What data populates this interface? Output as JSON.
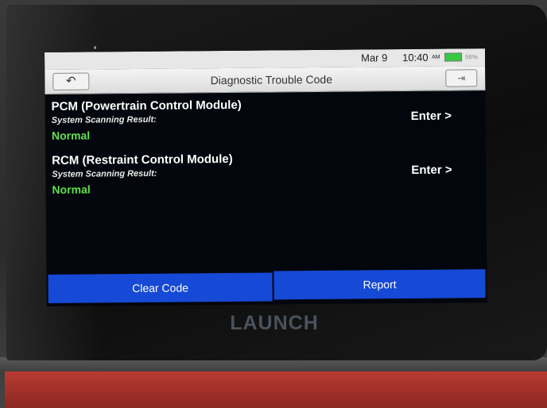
{
  "status_bar": {
    "date": "Mar 9",
    "time": "10:40",
    "ampm": "AM",
    "battery_percent": "56%",
    "battery_icon": "battery-icon"
  },
  "title_bar": {
    "title": "Diagnostic Trouble Code",
    "back_icon": "back-arrow-icon",
    "exit_icon": "exit-icon"
  },
  "modules": [
    {
      "name": "PCM (Powertrain Control Module)",
      "subtitle": "System Scanning Result:",
      "status": "Normal",
      "enter_label": "Enter >"
    },
    {
      "name": "RCM (Restraint Control Module)",
      "subtitle": "System Scanning Result:",
      "status": "Normal",
      "enter_label": "Enter >"
    }
  ],
  "actions": {
    "clear_code": "Clear Code",
    "report": "Report"
  },
  "device": {
    "brand": "LAUNCH"
  },
  "colors": {
    "button_blue": "#1549d6",
    "status_green": "#5fe04a",
    "battery_green": "#35c843"
  }
}
